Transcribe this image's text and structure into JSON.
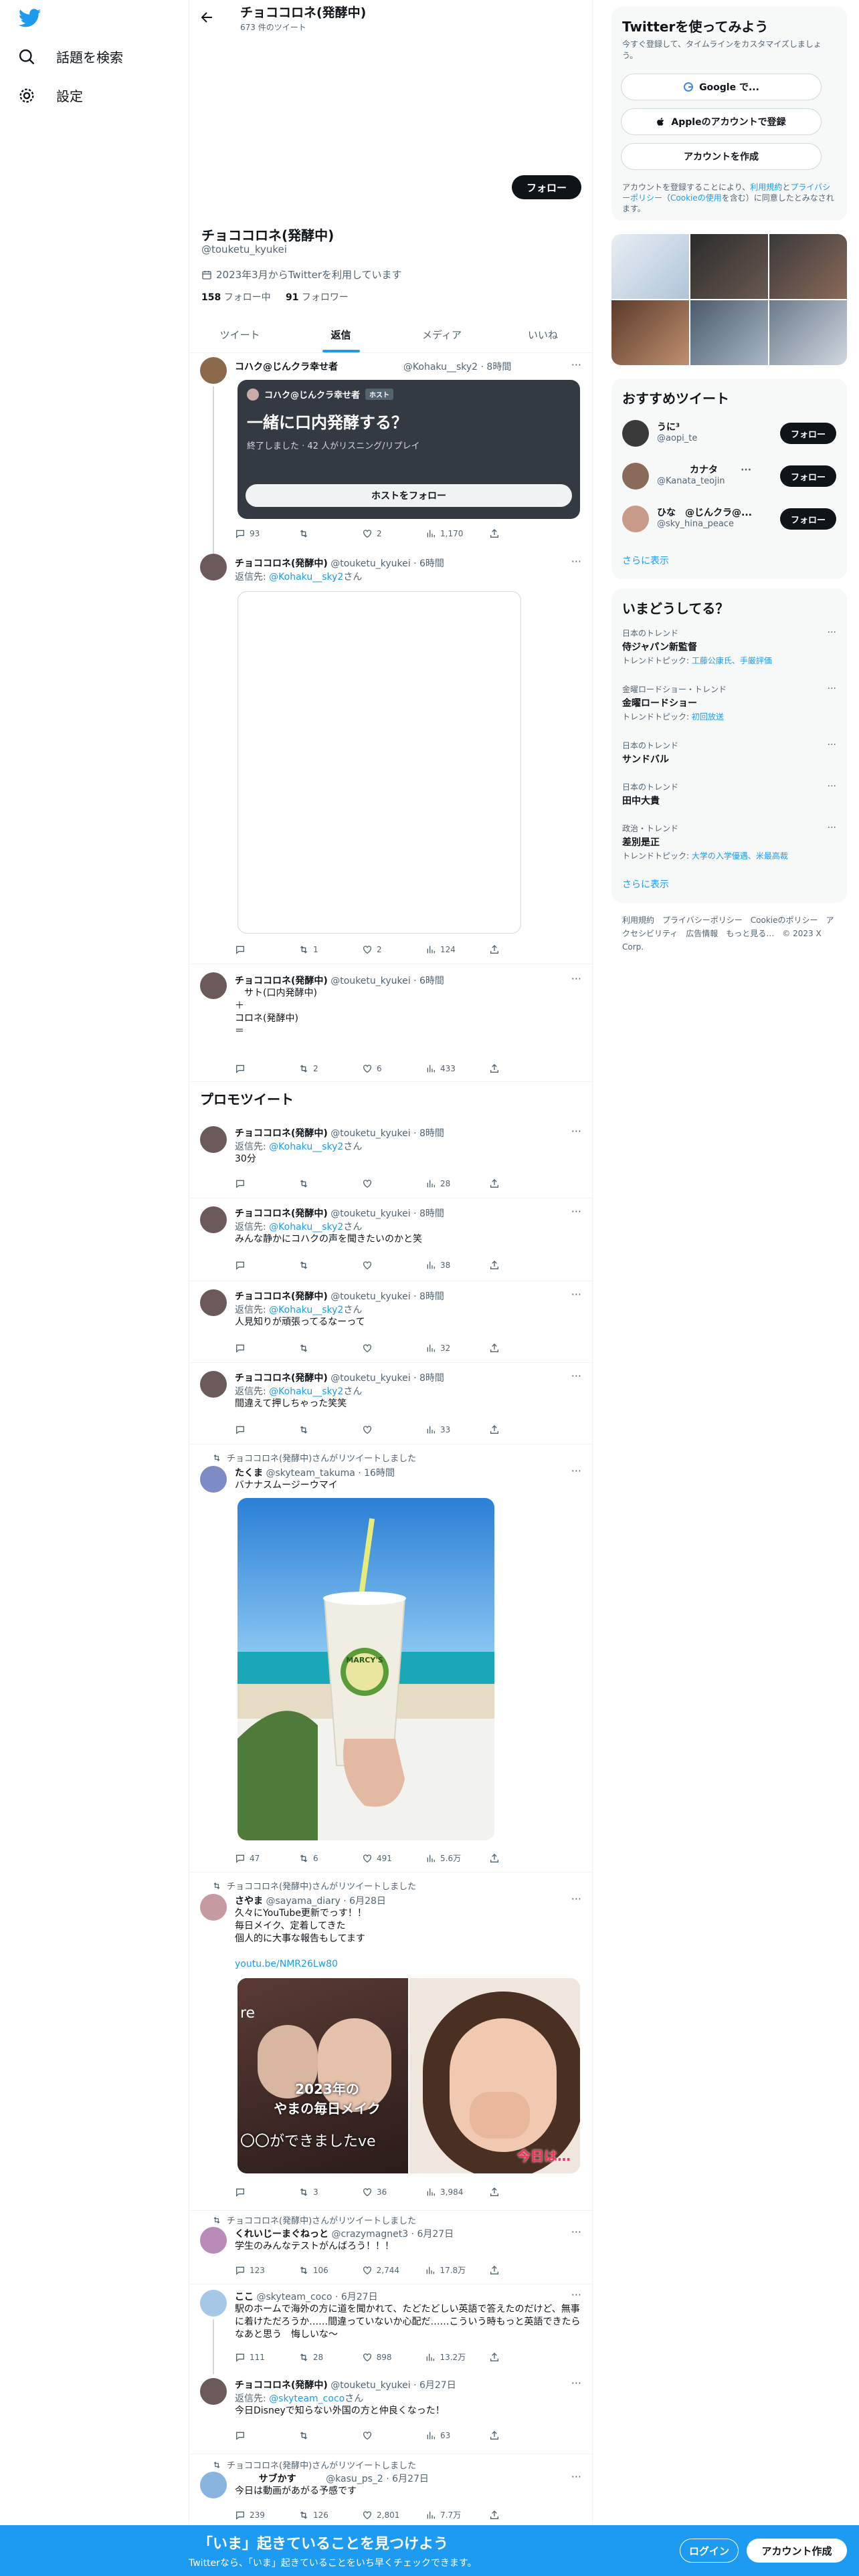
{
  "nav": {
    "explore_label": "話題を検索",
    "settings_label": "設定"
  },
  "header": {
    "title": "チョココロネ(発酵中)",
    "tweet_count": "673 件のツイート"
  },
  "profile": {
    "follow_label": "フォロー",
    "name": "チョココロネ(発酵中)",
    "handle": "@touketu_kyukei",
    "joined": "2023年3月からTwitterを利用しています",
    "following_count": "158",
    "following_label": "フォロー中",
    "followers_count": "91",
    "followers_label": "フォロワー"
  },
  "tabs": [
    {
      "label": "ツイート"
    },
    {
      "label": "返信"
    },
    {
      "label": "メディア"
    },
    {
      "label": "いいね"
    }
  ],
  "tweets": {
    "t1": {
      "name": "コハク@じんクラ幸せ者",
      "handle": "@Kohaku__sky2",
      "time": "· 8時間",
      "space_host": "コハク@じんクラ幸せ者",
      "host_badge": "ホスト",
      "space_title": "一緒に口内発酵する？",
      "space_status": "終了しました · 42 人がリスニング/リプレイ",
      "space_button": "ホストをフォロー",
      "replies": "93",
      "retweets": "",
      "likes": "2",
      "views": "1,170"
    },
    "t2": {
      "name": "チョココロネ(発酵中)",
      "handle": "@touketu_kyukei",
      "time": "· 6時間",
      "reply_prefix": "返信先:",
      "reply_to": "@Kohaku__sky2",
      "reply_suffix": "さん",
      "replies": "",
      "retweets": "1",
      "likes": "2",
      "views": "124"
    },
    "t3": {
      "name": "チョココロネ(発酵中)",
      "handle": "@touketu_kyukei",
      "time": "· 6時間",
      "text": "　サト(口内発酵中)\n＋\nコロネ(発酵中)\n＝",
      "replies": "",
      "retweets": "2",
      "likes": "6",
      "views": "433"
    },
    "t4": {
      "name": "チョココロネ(発酵中)",
      "handle": "@touketu_kyukei",
      "time": "· 8時間",
      "reply_prefix": "返信先:",
      "reply_to": "@Kohaku__sky2",
      "reply_suffix": "さん",
      "text": "30分",
      "views": "28"
    },
    "t5": {
      "name": "チョココロネ(発酵中)",
      "handle": "@touketu_kyukei",
      "time": "· 8時間",
      "reply_prefix": "返信先:",
      "reply_to": "@Kohaku__sky2",
      "reply_suffix": "さん",
      "text": "みんな静かにコハクの声を聞きたいのかと笑",
      "views": "38"
    },
    "t6": {
      "name": "チョココロネ(発酵中)",
      "handle": "@touketu_kyukei",
      "time": "· 8時間",
      "reply_prefix": "返信先:",
      "reply_to": "@Kohaku__sky2",
      "reply_suffix": "さん",
      "text": "人見知りが頑張ってるなーって",
      "views": "32"
    },
    "t7": {
      "name": "チョココロネ(発酵中)",
      "handle": "@touketu_kyukei",
      "time": "· 8時間",
      "reply_prefix": "返信先:",
      "reply_to": "@Kohaku__sky2",
      "reply_suffix": "さん",
      "text": "間違えて押しちゃった笑笑",
      "views": "33"
    },
    "t8": {
      "retweeted_by": "チョココロネ(発酵中)さんがリツイートしました",
      "name": "たくま",
      "handle": "@skyteam_takuma",
      "time": "· 16時間",
      "text": "バナナスムージーウマイ",
      "cup_label": "MARCY'S",
      "replies": "47",
      "retweets": "6",
      "likes": "491",
      "views": "5.6万"
    },
    "t9": {
      "retweeted_by": "チョココロネ(発酵中)さんがリツイートしました",
      "name": "さやま",
      "handle": "@sayama_diary",
      "time": "· 6月28日",
      "text": "久々にYouTube更新でっす！！\n毎日メイク、定着してきた\n個人的に大事な報告もしてます",
      "link": "youtu.be/NMR26Lw80",
      "img_left_top": "re",
      "img_left_mid": "2023年の\nやまの毎日メイク",
      "img_left_bottom": "〇〇ができましたve",
      "img_right_caption": "今日は…",
      "replies": "",
      "retweets": "3",
      "likes": "36",
      "views": "3,984"
    },
    "t10": {
      "retweeted_by": "チョココロネ(発酵中)さんがリツイートしました",
      "name": "くれいじーまぐねっと",
      "handle": "@crazymagnet3",
      "time": "· 6月27日",
      "text": "学生のみんなテストがんばろう！！！",
      "replies": "123",
      "retweets": "106",
      "likes": "2,744",
      "views": "17.8万"
    },
    "t11": {
      "name": "ここ",
      "handle": "@skyteam_coco",
      "time": "· 6月27日",
      "text": "駅のホームで海外の方に道を聞かれて、たどたどしい英語で答えたのだけど、無事に着けただろうか……間違っていないか心配だ……こういう時もっと英語できたらなあと思う　悔しいな〜",
      "replies": "111",
      "retweets": "28",
      "likes": "898",
      "views": "13.2万"
    },
    "t12": {
      "name": "チョココロネ(発酵中)",
      "handle": "@touketu_kyukei",
      "time": "· 6月27日",
      "reply_prefix": "返信先:",
      "reply_to": "@skyteam_coco",
      "reply_suffix": "さん",
      "text": "今日Disneyで知らない外国の方と仲良くなった！",
      "views": "63"
    },
    "t13": {
      "retweeted_by": "チョココロネ(発酵中)さんがリツイートしました",
      "name": "サブかす",
      "handle": "@kasu_ps_2",
      "time": "· 6月27日",
      "text": "今日は動画があがる予感です",
      "replies": "239",
      "retweets": "126",
      "likes": "2,801",
      "views": "7.7万"
    }
  },
  "promo_title": "プロモツイート",
  "sidebar": {
    "signup_title": "Twitterを使ってみよう",
    "signup_sub": "今すぐ登録して、タイムラインをカスタマイズしましょう。",
    "google_btn": "Google で...",
    "apple_btn": "Appleのアカウントで登録",
    "create_btn": "アカウントを作成",
    "terms_1": "アカウントを登録することにより、",
    "terms_link1": "利用規約",
    "terms_2": "と",
    "terms_link2": "プライバシーポリシー",
    "terms_3": "（",
    "terms_link3": "Cookieの使用",
    "terms_4": "を含む）に同意したとみなされます。",
    "rec_title": "おすすめツイート",
    "rec_users": [
      {
        "name": "うに³",
        "handle": "@aopi_te",
        "btn": "フォロー"
      },
      {
        "name": "カナタ",
        "handle": "@Kanata_teojin",
        "btn": "フォロー"
      },
      {
        "name": "ひな　@じんクラ@...",
        "handle": "@sky_hina_peace",
        "btn": "フォロー"
      }
    ],
    "rec_more": "さらに表示",
    "trends_title": "いまどうしてる？",
    "trends": [
      {
        "cat": "日本のトレンド",
        "name": "侍ジャパン新監督",
        "topic_prefix": "トレンドトピック: ",
        "topic": "工藤公康氏、手厳評価"
      },
      {
        "cat": "金曜ロードショー・トレンド",
        "name": "金曜ロードショー",
        "topic_prefix": "トレンドトピック: ",
        "topic": "初回放送"
      },
      {
        "cat": "日本のトレンド",
        "name": "サンドバル",
        "topic_prefix": "",
        "topic": ""
      },
      {
        "cat": "日本のトレンド",
        "name": "田中大貴",
        "topic_prefix": "",
        "topic": ""
      },
      {
        "cat": "政治・トレンド",
        "name": "差別是正",
        "topic_prefix": "トレンドトピック: ",
        "topic": "大学の入学優遇、米最高裁"
      }
    ],
    "trends_more": "さらに表示",
    "footer": "利用規約　プライバシーポリシー　Cookieのポリシー　アクセシビリティ　広告情報　もっと見る…　© 2023 X Corp."
  },
  "banner": {
    "title": "「いま」起きていることを見つけよう",
    "sub": "Twitterなら、「いま」起きていることをいち早くチェックできます。",
    "login": "ログイン",
    "signup": "アカウント作成"
  }
}
